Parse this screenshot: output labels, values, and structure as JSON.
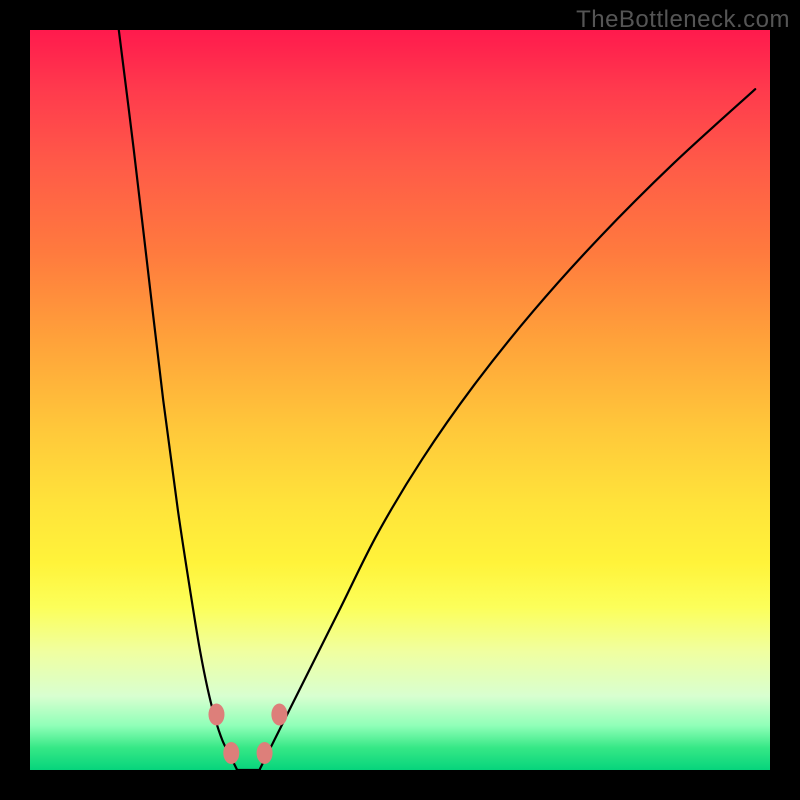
{
  "watermark": "TheBottleneck.com",
  "chart_data": {
    "type": "line",
    "title": "",
    "xlabel": "",
    "ylabel": "",
    "ylim": [
      0,
      100
    ],
    "xlim": [
      0,
      100
    ],
    "series": [
      {
        "name": "left-branch",
        "x": [
          12,
          14,
          16,
          18,
          20,
          22,
          23,
          24,
          25,
          26,
          27,
          28
        ],
        "y": [
          100,
          84,
          67,
          50,
          35,
          22,
          16,
          11,
          7,
          4,
          2,
          0
        ]
      },
      {
        "name": "right-branch",
        "x": [
          31,
          32,
          33,
          35,
          38,
          42,
          47,
          53,
          60,
          68,
          77,
          87,
          98
        ],
        "y": [
          0,
          2,
          4,
          8,
          14,
          22,
          32,
          42,
          52,
          62,
          72,
          82,
          92
        ]
      },
      {
        "name": "trough",
        "x": [
          28,
          29.5,
          31
        ],
        "y": [
          0,
          0,
          0
        ]
      }
    ],
    "markers": {
      "color": "#dd7f7a",
      "points": [
        {
          "x": 25.2,
          "y": 7.5
        },
        {
          "x": 27.2,
          "y": 2.3
        },
        {
          "x": 31.7,
          "y": 2.3
        },
        {
          "x": 33.7,
          "y": 7.5
        }
      ]
    },
    "curve_color": "#000000",
    "curve_width": 2.2
  }
}
